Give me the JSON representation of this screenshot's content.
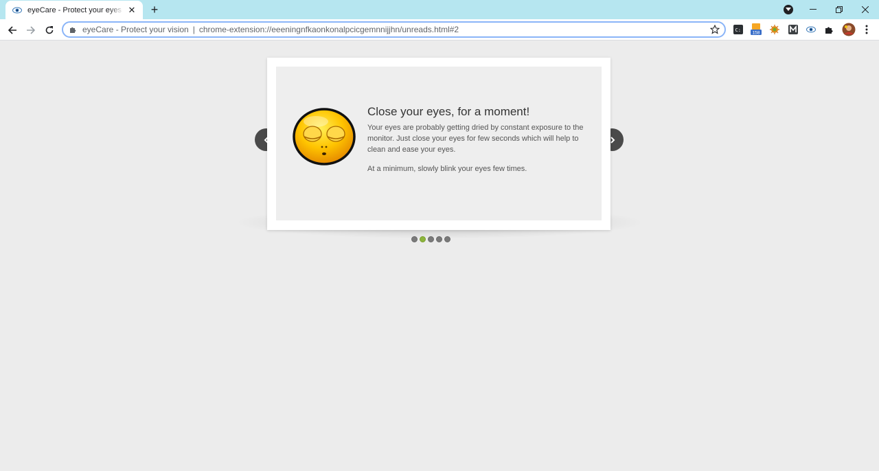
{
  "browser": {
    "tab": {
      "title": "eyeCare - Protect your eyes and vision",
      "favicon": "eye-icon"
    },
    "omnibox": {
      "site_name": "eyeCare - Protect your vision",
      "separator": "|",
      "url": "chrome-extension://eeeningnfkaonkonalpcicgemnnijjhn/unreads.html#2"
    },
    "extensions": [
      {
        "name": "terminal-extension-icon"
      },
      {
        "name": "rss-extension-icon",
        "badge": "158"
      },
      {
        "name": "bug-extension-icon"
      },
      {
        "name": "m-extension-icon"
      },
      {
        "name": "eye-extension-icon"
      },
      {
        "name": "puzzle-extensions-icon"
      },
      {
        "name": "profile-avatar"
      },
      {
        "name": "menu-kebab-icon"
      }
    ]
  },
  "slide": {
    "heading": "Close your eyes, for a moment!",
    "body": "Your eyes are probably getting dried by constant exposure to the monitor. Just close your eyes for few seconds which will help to clean and ease your eyes.",
    "tip": "At a minimum, slowly blink your eyes few times.",
    "image": "sleepy-face-emoji"
  },
  "pagination": {
    "total": 5,
    "active_index": 1
  },
  "colors": {
    "titlebar": "#b6e6f0",
    "page_bg": "#ececec",
    "dot_active": "#8cb43c",
    "arrow_bg": "#4a4a4a"
  }
}
